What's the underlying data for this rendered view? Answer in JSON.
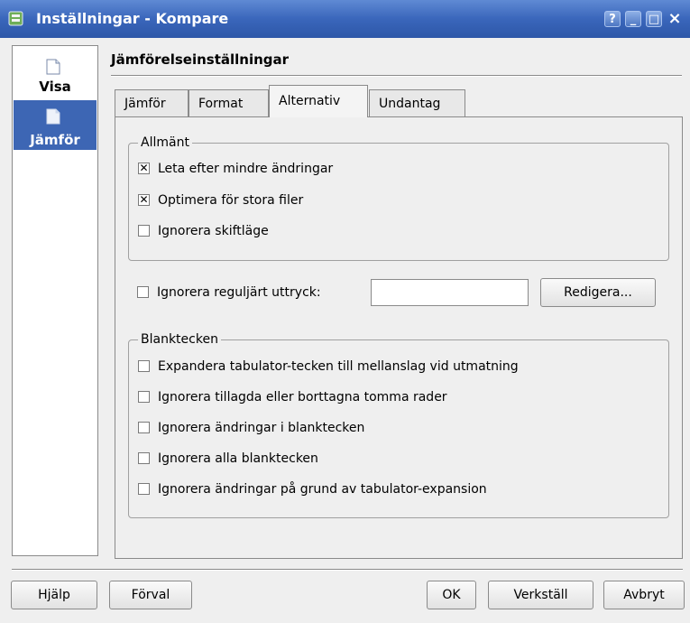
{
  "window": {
    "title": "Inställningar - Kompare",
    "help_btn": "?",
    "min_btn": "_",
    "max_btn": "□",
    "close_btn": "×"
  },
  "nav": {
    "items": [
      {
        "label": "Visa",
        "icon": "document-icon"
      },
      {
        "label": "Jämför",
        "icon": "document-icon",
        "selected": true
      }
    ]
  },
  "page": {
    "title": "Jämförelseinställningar"
  },
  "tabs": [
    {
      "label": "Jämför"
    },
    {
      "label": "Format"
    },
    {
      "label": "Alternativ",
      "active": true
    },
    {
      "label": "Undantag"
    }
  ],
  "general": {
    "title": "Allmänt",
    "options": [
      {
        "label": "Leta efter mindre ändringar",
        "checked": true
      },
      {
        "label": "Optimera för stora filer",
        "checked": true
      },
      {
        "label": "Ignorera skiftläge",
        "checked": false
      }
    ]
  },
  "regex": {
    "label": "Ignorera reguljärt uttryck:",
    "checked": false,
    "value": "",
    "edit_button": "Redigera..."
  },
  "whitespace": {
    "title": "Blanktecken",
    "options": [
      {
        "label": "Expandera tabulator-tecken till mellanslag vid utmatning",
        "checked": false
      },
      {
        "label": "Ignorera tillagda eller borttagna tomma rader",
        "checked": false
      },
      {
        "label": "Ignorera ändringar i blanktecken",
        "checked": false
      },
      {
        "label": "Ignorera alla blanktecken",
        "checked": false
      },
      {
        "label": "Ignorera ändringar på grund av tabulator-expansion",
        "checked": false
      }
    ]
  },
  "footer": {
    "help": "Hjälp",
    "defaults": "Förval",
    "ok": "OK",
    "apply": "Verkställ",
    "cancel": "Avbryt"
  },
  "colors": {
    "titlebar": "#3a66bb",
    "nav_selected": "#3d66b4",
    "background": "#efefef"
  }
}
